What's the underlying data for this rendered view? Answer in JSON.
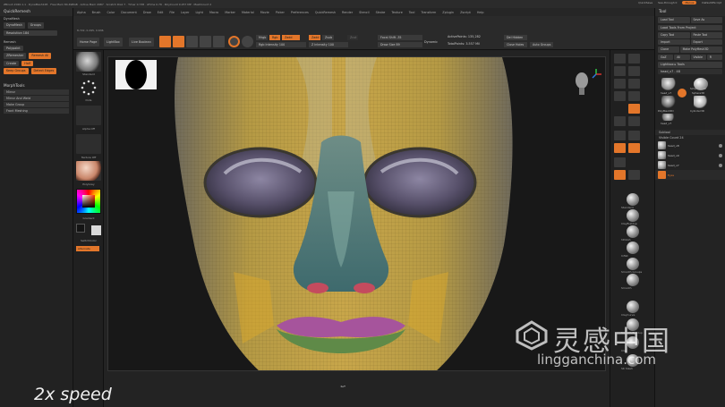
{
  "window": {
    "title": "ZBrush 2020.1.1 · DynaMesh128 · Free Mem 84.498GB · Active Mem 2987 · Scratch Disk 7 · Timer 0.738 · ATime 0.76 · PolyCount 9.257 MP · MeshCount 2",
    "right_items": [
      "QuickSave",
      "See-through 0",
      "Menus",
      "DefaultZScript"
    ],
    "colors": {
      "accent": "#e3762a",
      "panel": "#222222",
      "canvas": "#181818"
    }
  },
  "menubar": [
    "Alpha",
    "Brush",
    "Color",
    "Document",
    "Draw",
    "Edit",
    "File",
    "Layer",
    "Light",
    "Macro",
    "Marker",
    "Material",
    "Movie",
    "Picker",
    "Preferences",
    "QuickRemesh",
    "Render",
    "Stencil",
    "Stroke",
    "Texture",
    "Tool",
    "Transform",
    "Zplugin",
    "Zscript",
    "Help"
  ],
  "left_panel": {
    "title": "QuickRemesh",
    "dynamesh": {
      "header": "DynaMesh",
      "groups_label": "Groups",
      "dynamesh_label": "DynaMesh",
      "resolution_label": "Resolution 184"
    },
    "remesh": {
      "header": "Remesh",
      "polypaint_label": "Polypaint",
      "zremesher_label": "ZRemesher",
      "remesh_all": "Remesh All",
      "keep_groups": "Keep Groups",
      "detect_edges": "Detect Edges",
      "create": "Create",
      "half": "Half"
    },
    "morph_section": "MorphTools",
    "items": [
      "Mirror",
      "Mirror And Weld",
      "Make Group",
      "Front Meshing"
    ]
  },
  "toolbar": {
    "info": "8.722, 0.295, 0.636",
    "home_page": "Home Page",
    "lightbox": "LightBox",
    "live_boolean": "Live Boolean",
    "edit": "Edit",
    "draw": "Draw",
    "move": "Move",
    "scale": "Scale",
    "rotate": "Rotate",
    "mrgb": "Mrgb",
    "rgb": "Rgb",
    "m": "M",
    "zadd": "Zadd",
    "zsub": "Zsub",
    "zcut": "Zcut",
    "rgb_intensity": "Rgb Intensity 100",
    "z_intensity": "Z Intensity 100",
    "focal_shift": "Focal Shift -35",
    "draw_size": "Draw Size 89",
    "dynamic": "Dynamic",
    "active_points": "ActivePoints: 135,282",
    "total_points": "TotalPoints: 3.557 Mil",
    "sel_hidden": "Del Hidden",
    "close_holes": "Close Holes",
    "auto_groups": "Auto Groups"
  },
  "left_shelf": {
    "brush_label": "Standard",
    "dots_label": "Dots",
    "alpha_label": "Alpha Off",
    "texture_label": "Texture Off",
    "material_label": "PolyGrey",
    "gradient_label": "Gradient",
    "switch_color": "SwitchColor",
    "alternate": "Alternate"
  },
  "canvas": {
    "speed_overlay": "2x speed",
    "bottom_handle": "◂▴▾"
  },
  "right_shelf": {
    "labels": [
      "BPR",
      "SPix 3",
      "Persp",
      "Floor",
      "Local",
      "Frame",
      "Move",
      "Zoom3D",
      "Rotate",
      "Transp",
      "Ghost",
      "Solo",
      "Xpose"
    ],
    "brushes": [
      "Standard",
      "ClayBuildup",
      "hPolish",
      "Inflat",
      "Smooth Groups",
      "Smooth",
      "ClayCurve",
      "Smooth Buildup",
      "Clay",
      "SK Slash"
    ]
  },
  "tool_panel": {
    "title": "Tool",
    "buttons": [
      "Load Tool",
      "Save As",
      "Load Tools From Project",
      "Copy Tool",
      "Paste Tool",
      "Import",
      "Export",
      "Clone",
      "Make PolyMesh3D",
      "GoZ",
      "All",
      "Visible",
      "R"
    ],
    "lightbox_tools": "Lightbox ▸ Tools",
    "current_tool": "head_v7 . 48",
    "thumbs": [
      "head_v7",
      "Sphere3D",
      "SimpleBrush",
      "PolyMesh3D",
      "Cylinder3D",
      "head_v7"
    ],
    "subtool_header": "Subtool",
    "visible_count": "Visible Count 24",
    "subtools": [
      "head_v8",
      "head_v9",
      "head_v7"
    ],
    "subtool_label2": "Eyes"
  },
  "watermark": {
    "cn": "灵感中国",
    "url": "lingganchina.com"
  }
}
